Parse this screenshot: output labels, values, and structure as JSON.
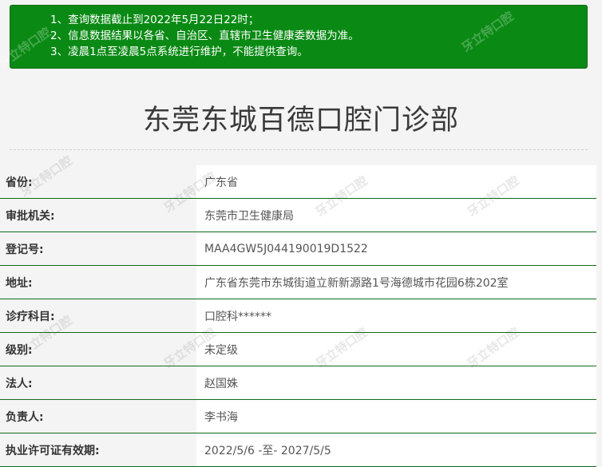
{
  "notice": {
    "lines": [
      "1、查询数据截止到2022年5月22日22时；",
      "2、信息数据结果以各省、自治区、直辖市卫生健康委数据为准。",
      "3、凌晨1点至凌晨5点系统进行维护，不能提供查询。"
    ]
  },
  "page_title": "东莞东城百德口腔门诊部",
  "info": {
    "rows": [
      {
        "label": "省份:",
        "value": "广东省"
      },
      {
        "label": "审批机关:",
        "value": "东莞市卫生健康局"
      },
      {
        "label": "登记号:",
        "value": "MAA4GW5J044190019D1522"
      },
      {
        "label": "地址:",
        "value": "广东省东莞市东城街道立新新源路1号海德城市花园6栋202室"
      },
      {
        "label": "诊疗科目:",
        "value": "口腔科******"
      },
      {
        "label": "级别:",
        "value": "未定级"
      },
      {
        "label": "法人:",
        "value": "赵国姝"
      },
      {
        "label": "负责人:",
        "value": "李书海"
      },
      {
        "label": "执业许可证有效期:",
        "value": "2022/5/6 -至- 2027/5/5"
      }
    ]
  },
  "watermark": "牙立特口腔"
}
